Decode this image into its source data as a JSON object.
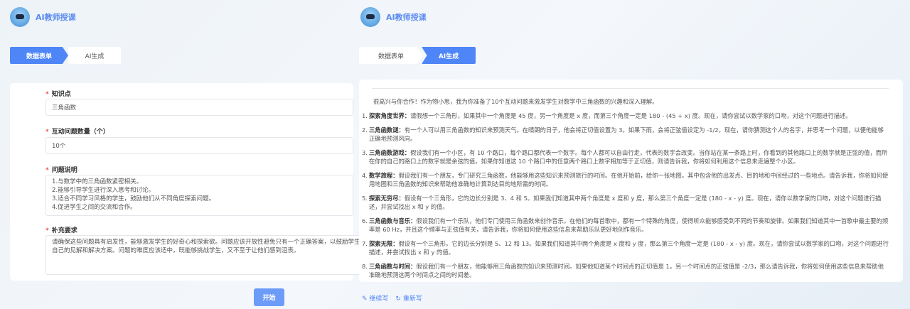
{
  "app": {
    "title": "AI教师授课"
  },
  "steps": [
    "数据表单",
    "AI生成"
  ],
  "form": {
    "fields": [
      {
        "label": "知识点",
        "value": "三角函数"
      },
      {
        "label": "互动问题数量（个）",
        "value": "10个"
      },
      {
        "label": "问题说明",
        "lines": [
          "1.与数学中的三角函数紧密相关。",
          "2.能够引导学生进行深入思考和讨论。",
          "3.适合不同学习风格的学生，鼓励他们从不同角度探索问题。",
          "4.促进学生之间的交流和合作。"
        ]
      },
      {
        "label": "补充要求",
        "value": "请确保这些问题具有启发性，能够激发学生的好奇心和探索欲。问题应该开放性避免只有一个正确答案，以鼓励学生提出自己的见解和解决方案。问题的难度应该适中，既能够挑战学生，又不至于让他们感到沮丧。"
      }
    ],
    "start_label": "开始"
  },
  "result": {
    "intro": "很高兴与你合作！作为物小思，我为你准备了10个互动问题来激发学生对数学中三角函数的兴趣和深入理解。",
    "items": [
      {
        "n": "1.",
        "title": "探索角度世界：",
        "text": "请假想一个三角形，如果其中一个角度是 45 度，另一个角度是 x 度，而第三个角度一定是 180 - (45 + x) 度。现在，请你尝试以数学家的口吻，对这个问题进行描述。"
      },
      {
        "n": "2.",
        "title": "三角函数谜：",
        "text": "有一个人可以用三角函数的知识来预测天气。在晴朗的日子，他会将正切值设置为 3。如果下雨，会将正弦值设定为 -1/2。现在，请你猜测这个人的名字，并思考一个问题，以便他能够正确地预测风向。"
      },
      {
        "n": "3.",
        "title": "三角函数游戏：",
        "text": "假设我们有一个小区，有 10 个路口，每个路口都代表一个数字。每个人都可以自由行走，代表的数字会改变。当你站在某一条路上时，你看到的其他路口上的数字就是正弦的值，而所在你的自己的路口上的数字就是余弦的值。如果你知道这 10 个路口中的任意两个路口上数字相加等于正切值，则请告诉我，你将如何利用这个信息来走遍整个小区。"
      },
      {
        "n": "4.",
        "title": "数学旅程：",
        "text": "假设我们有一个朋友，专门研究三角函数，他能够用这些知识来预测旅行的时间。在他开始前，给你一张地图，其中包含他的出发点、目的地和中间经过的一些地点。请告诉我，你将如何使用地图和三角函数的知识来帮助他准确地计算到达目的地所需的时间。"
      },
      {
        "n": "5.",
        "title": "探索无穷尽：",
        "text": "假设有一个三角形，它的边长分别是 3、4 和 5。如果我们知道其中两个角度是 x 度和 y 度，那么第三个角度一定是 (180 - x - y) 度。现在，请你以数学家的口吻，对这个问题进行描述，并尝试找出 x 和 y 的值。"
      },
      {
        "n": "6.",
        "title": "三角函数与音乐：",
        "text": "假设我们有一个乐队，他们专门使用三角函数来创作音乐。在他们的每首歌中，都有一个特殊的角度，使得听众能够感受到不同的节奏和旋律。如果我们知道其中一首歌中最主要的频率是 60 Hz，并且这个频率与正弦值有关，请告诉我，你将如何使用这些信息来帮助乐队更好地创作音乐。"
      },
      {
        "n": "7.",
        "title": "探索无限：",
        "text": "假设有一个三角形，它的边长分别是 5、12 和 13。如果我们知道其中两个角度是 x 度和 y 度，那么第三个角度一定是 (180 - x - y) 度。现在，请你尝试以数学家的口吻，对这个问题进行描述，并尝试找出 x 和 y 的值。"
      },
      {
        "n": "8.",
        "title": "三角函数与时间：",
        "text": "假设我们有一个朋友，他能够用三角函数的知识来预测时间。如果他知道某个时间点的正切值是 1，另一个时间点的正弦值是 -2/3，那么请告诉我，你将如何使用这些信息来帮助他准确地预测这两个时间点之间的时间差。"
      }
    ],
    "continue_label": "继续写",
    "rewrite_label": "重新写"
  },
  "colors": {
    "accent": "#4f86f7",
    "required": "#e55555"
  }
}
